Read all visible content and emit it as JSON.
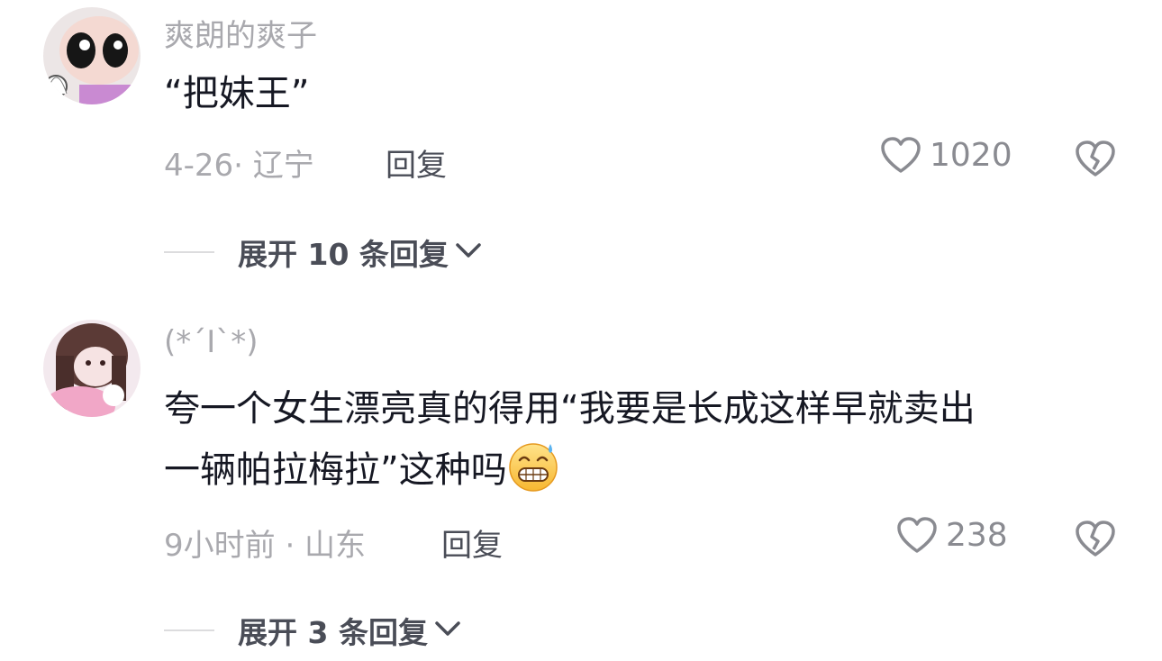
{
  "comments": [
    {
      "username": "爽朗的爽子",
      "text": "“把妹王”",
      "meta": "4-26· 辽宁",
      "reply_label": "回复",
      "likes": "1020",
      "expand_label": "展开 10 条回复",
      "avatar_icon": "cartoon-girl-avatar"
    },
    {
      "username": "(*´I`*)",
      "text_line1": "夸一个女生漂亮真的得用“我要是长成这样早就卖出",
      "text_line2": "一辆帕拉梅拉”这种吗",
      "emoji": "grimacing-sweat-emoji",
      "meta": "9小时前 · 山东",
      "reply_label": "回复",
      "likes": "238",
      "expand_label": "展开 3 条回复",
      "avatar_icon": "anime-girl-avatar"
    }
  ],
  "colors": {
    "primary_text": "#161823",
    "secondary_text": "#a9a9ae",
    "action_text": "#4a4d57",
    "icon": "#8a8b91"
  }
}
